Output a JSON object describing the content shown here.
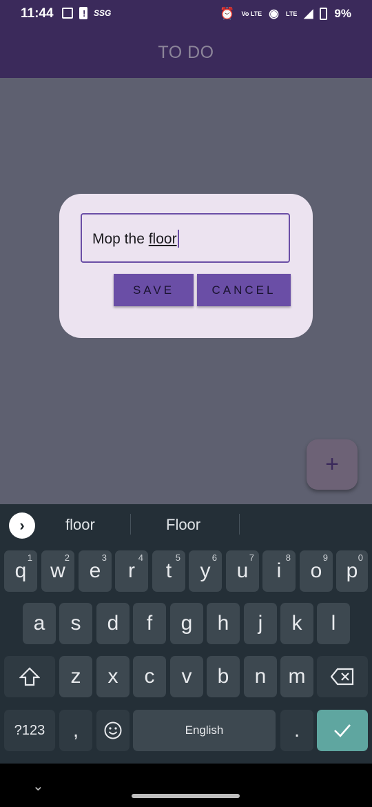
{
  "status_bar": {
    "time": "11:44",
    "carrier_tag": "SSG",
    "volte": "Vo LTE",
    "lte": "LTE",
    "battery": "9%"
  },
  "app_bar": {
    "title": "TO DO"
  },
  "dialog": {
    "input_value_plain": "Mop the ",
    "input_value_underlined": "floor",
    "save_label": "SAVE",
    "cancel_label": "CANCEL"
  },
  "fab": {
    "label": "+"
  },
  "keyboard": {
    "suggestions": [
      "floor",
      "Floor"
    ],
    "row1": [
      {
        "key": "q",
        "num": "1"
      },
      {
        "key": "w",
        "num": "2"
      },
      {
        "key": "e",
        "num": "3"
      },
      {
        "key": "r",
        "num": "4"
      },
      {
        "key": "t",
        "num": "5"
      },
      {
        "key": "y",
        "num": "6"
      },
      {
        "key": "u",
        "num": "7"
      },
      {
        "key": "i",
        "num": "8"
      },
      {
        "key": "o",
        "num": "9"
      },
      {
        "key": "p",
        "num": "0"
      }
    ],
    "row2": [
      "a",
      "s",
      "d",
      "f",
      "g",
      "h",
      "j",
      "k",
      "l"
    ],
    "row3": [
      "z",
      "x",
      "c",
      "v",
      "b",
      "n",
      "m"
    ],
    "symbols_label": "?123",
    "comma_label": ",",
    "space_label": "English",
    "period_label": "."
  }
}
